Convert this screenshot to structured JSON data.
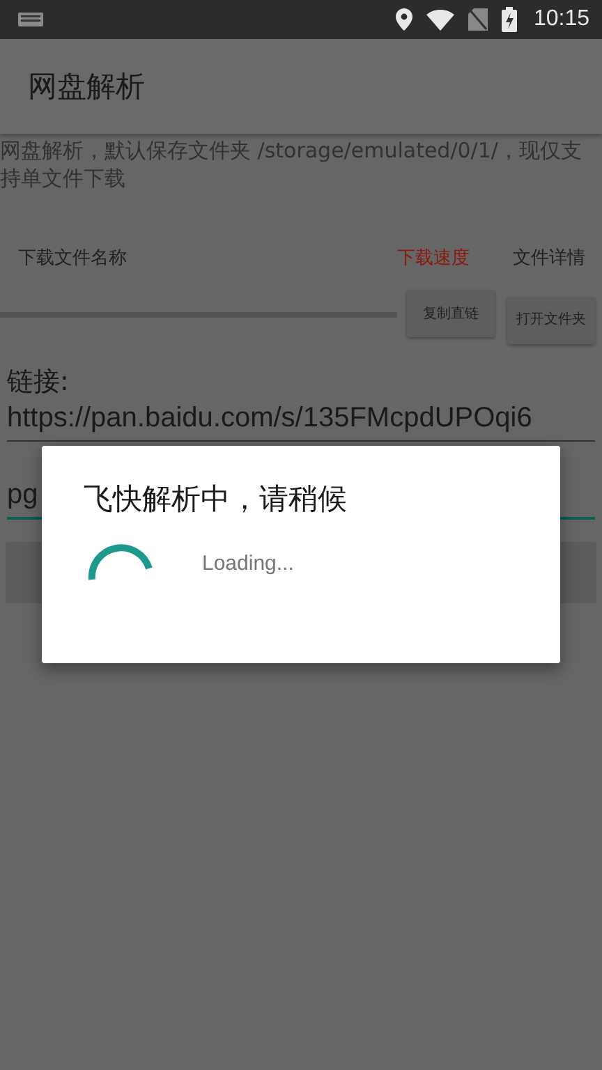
{
  "status_bar": {
    "time": "10:15"
  },
  "app_bar": {
    "title": "网盘解析"
  },
  "description": "网盘解析，默认保存文件夹 /storage/emulated/0/1/，现仅支持单文件下载",
  "columns": [
    {
      "label": "下载文件名称",
      "color": "#222222"
    },
    {
      "label": "下载速度",
      "color": "#8a1a12"
    },
    {
      "label": "文件详情",
      "color": "#222222"
    }
  ],
  "actions": [
    {
      "label": "复制直链"
    },
    {
      "label": "打开文件夹"
    }
  ],
  "link_field": {
    "label": "链接:",
    "value": "https://pan.baidu.com/s/135FMcpdUPOqi6",
    "focused": false
  },
  "code_field": {
    "value": "pg",
    "focused": true
  },
  "dialog": {
    "title": "飞快解析中，请稍候",
    "message": "Loading..."
  }
}
